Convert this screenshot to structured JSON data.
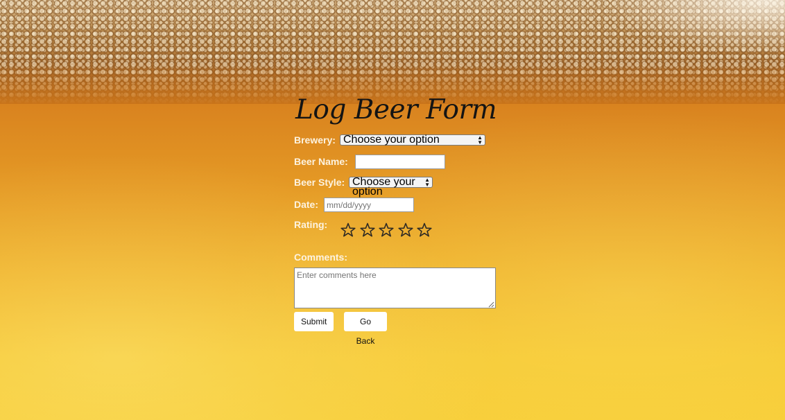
{
  "form": {
    "title": "Log Beer Form",
    "brewery": {
      "label": "Brewery:",
      "selected": "Choose your option"
    },
    "beer_name": {
      "label": "Beer Name:",
      "value": ""
    },
    "beer_style": {
      "label": "Beer Style:",
      "selected": "Choose your option"
    },
    "date": {
      "label": "Date:",
      "placeholder": "mm/dd/yyyy"
    },
    "rating": {
      "label": "Rating:",
      "stars_total": 5,
      "stars_filled": 0,
      "star_icon": "star-outline-icon"
    },
    "comments": {
      "label": "Comments:",
      "placeholder": "Enter comments here"
    },
    "buttons": {
      "submit": "Submit",
      "go_back": "Go Back"
    }
  },
  "colors": {
    "label_text": "#fdf3e0",
    "title_text": "#141414",
    "star_outline": "#2e2a24"
  }
}
